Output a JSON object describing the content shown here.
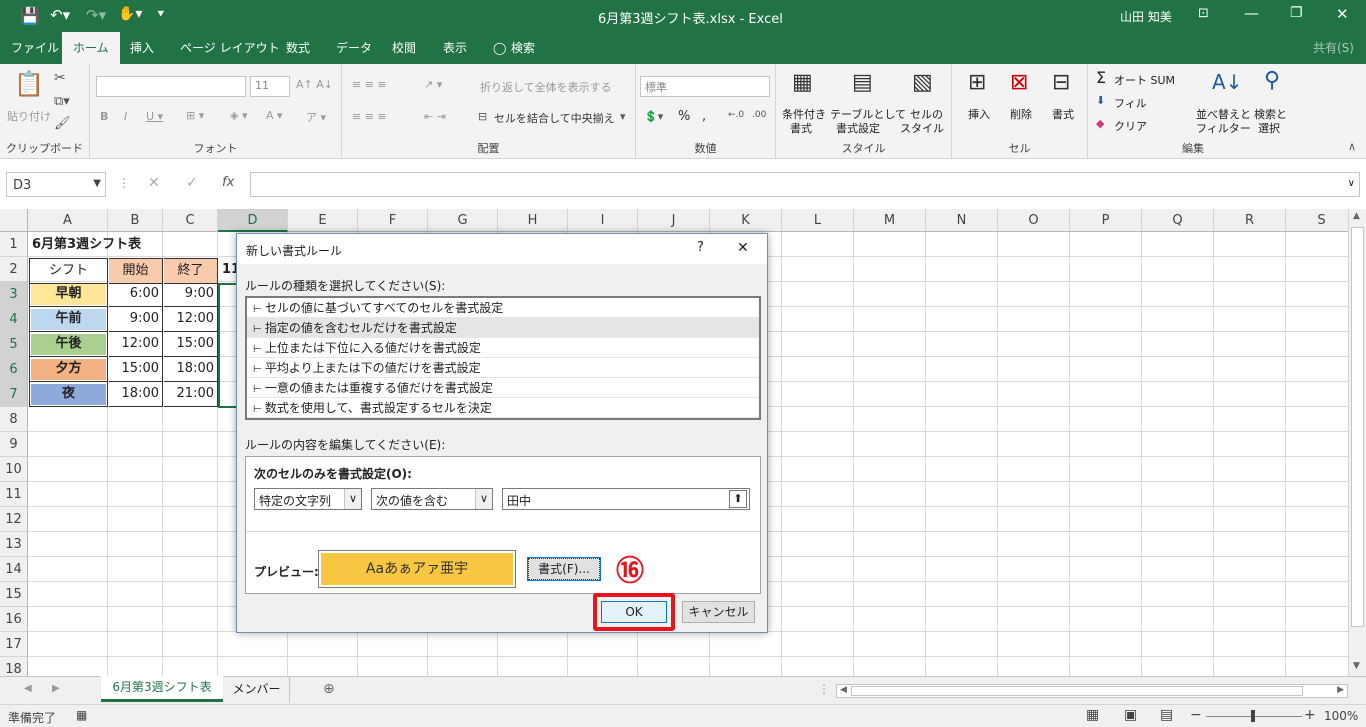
{
  "titlebar": {
    "title": "6月第3週シフト表.xlsx - Excel",
    "user": "山田 知美"
  },
  "tabs": {
    "file": "ファイル",
    "home": "ホーム",
    "insert": "挿入",
    "page_layout": "ページ レイアウト",
    "formulas": "数式",
    "data": "データ",
    "review": "校閲",
    "view": "表示",
    "search": "検索",
    "share": "共有(S)"
  },
  "ribbon": {
    "clipboard": {
      "label": "クリップボード",
      "paste": "貼り付け"
    },
    "font": {
      "label": "フォント",
      "size": "11"
    },
    "alignment": {
      "label": "配置",
      "wrap": "折り返して全体を表示する",
      "merge": "セルを結合して中央揃え"
    },
    "number": {
      "label": "数値",
      "format": "標準"
    },
    "styles": {
      "label": "スタイル",
      "cond1": "条件付き",
      "cond2": "書式",
      "table1": "テーブルとして",
      "table2": "書式設定",
      "cell1": "セルの",
      "cell2": "スタイル"
    },
    "cells": {
      "label": "セル",
      "insert": "挿入",
      "delete": "削除",
      "format": "書式"
    },
    "editing": {
      "label": "編集",
      "autosum": "オート SUM",
      "fill": "フィル",
      "clear": "クリア",
      "sort1": "並べ替えと",
      "sort2": "フィルター",
      "find1": "検索と",
      "find2": "選択"
    }
  },
  "formula_bar": {
    "name_box": "D3",
    "formula": ""
  },
  "columns": [
    "A",
    "B",
    "C",
    "D",
    "E",
    "F",
    "G",
    "H",
    "I",
    "J",
    "K",
    "L",
    "M",
    "N",
    "O",
    "P",
    "Q",
    "R",
    "S"
  ],
  "rows": [
    "1",
    "2",
    "3",
    "4",
    "5",
    "6",
    "7",
    "8",
    "9",
    "10",
    "11",
    "12",
    "13",
    "14",
    "15",
    "16",
    "17",
    "18"
  ],
  "sheet": {
    "title": "6月第3週シフト表",
    "headers": [
      "シフト",
      "開始",
      "終了"
    ],
    "d2_partial": "11",
    "shifts": [
      {
        "name": "早朝",
        "start": "6:00",
        "end": "9:00"
      },
      {
        "name": "午前",
        "start": "9:00",
        "end": "12:00"
      },
      {
        "name": "午後",
        "start": "12:00",
        "end": "15:00"
      },
      {
        "name": "夕方",
        "start": "15:00",
        "end": "18:00"
      },
      {
        "name": "夜",
        "start": "18:00",
        "end": "21:00"
      }
    ]
  },
  "colors": {
    "excel_green": "#217346",
    "early": "#ffe699",
    "morning": "#bdd7ee",
    "afternoon": "#a9d08e",
    "evening": "#f4b183",
    "night": "#8ea9db",
    "header_pink": "#f8cbad",
    "preview_bg": "#f7c742",
    "highlight_red": "#e8141b"
  },
  "dialog": {
    "title": "新しい書式ルール",
    "help": "?",
    "close": "✕",
    "rule_type_label": "ルールの種類を選択してください(S):",
    "rule_types": [
      "セルの値に基づいてすべてのセルを書式設定",
      "指定の値を含むセルだけを書式設定",
      "上位または下位に入る値だけを書式設定",
      "平均より上または下の値だけを書式設定",
      "一意の値または重複する値だけを書式設定",
      "数式を使用して、書式設定するセルを決定"
    ],
    "rule_edit_label": "ルールの内容を編集してください(E):",
    "format_only_label": "次のセルのみを書式設定(O):",
    "condition1": "特定の文字列",
    "condition2": "次の値を含む",
    "value": "田中",
    "preview_label": "プレビュー:",
    "preview_text": "Aaあぁアァ亜宇",
    "format_button": "書式(F)...",
    "ok": "OK",
    "cancel": "キャンセル",
    "step": "⑯"
  },
  "sheet_tabs": [
    "6月第3週シフト表",
    "メンバー"
  ],
  "status": {
    "ready": "準備完了",
    "zoom": "100%"
  }
}
